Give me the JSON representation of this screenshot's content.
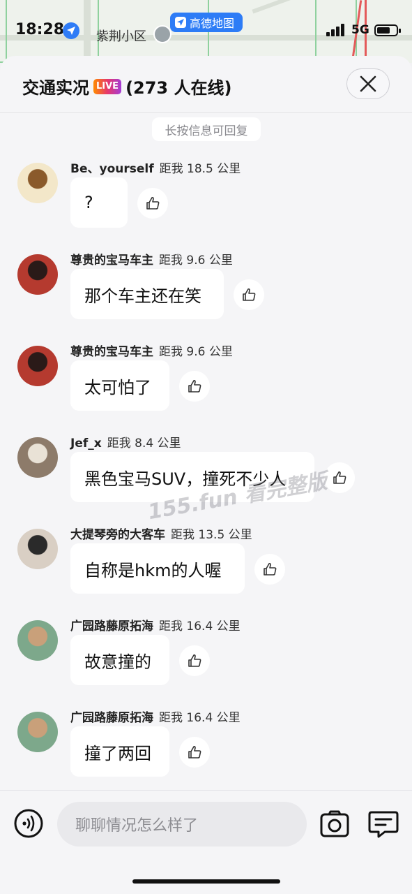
{
  "status_bar": {
    "time": "18:28",
    "map_label": "紫荆小区",
    "app_badge": "高德地图",
    "network": "5G"
  },
  "header": {
    "title": "交通实况",
    "live_badge": "LIVE",
    "online_count": "(273 人在线)"
  },
  "hint": "长按信息可回复",
  "messages": [
    {
      "name": "Be、yourself",
      "distance": "距我 18.5 公里",
      "text": "?"
    },
    {
      "name": "尊贵的宝马车主",
      "distance": "距我 9.6 公里",
      "text": "那个车主还在笑"
    },
    {
      "name": "尊贵的宝马车主",
      "distance": "距我 9.6 公里",
      "text": "太可怕了"
    },
    {
      "name": "Jef_x",
      "distance": "距我 8.4 公里",
      "text": "黑色宝马SUV，撞死不少人"
    },
    {
      "name": "大提琴旁的大客车",
      "distance": "距我 13.5 公里",
      "text": "自称是hkm的人喔"
    },
    {
      "name": "广园路藤原拓海",
      "distance": "距我 16.4 公里",
      "text": "故意撞的"
    },
    {
      "name": "广园路藤原拓海",
      "distance": "距我 16.4 公里",
      "text": "撞了两回"
    }
  ],
  "watermark": "155.fun 看完整版",
  "input": {
    "placeholder": "聊聊情况怎么样了"
  },
  "icons": {
    "location": "location-arrow-icon",
    "close": "close-icon",
    "like": "thumbs-up-icon",
    "voice": "voice-icon",
    "camera": "camera-icon",
    "chat": "chat-icon"
  },
  "colors": {
    "accent_blue": "#2d7cf6",
    "background": "#f5f5f7"
  }
}
